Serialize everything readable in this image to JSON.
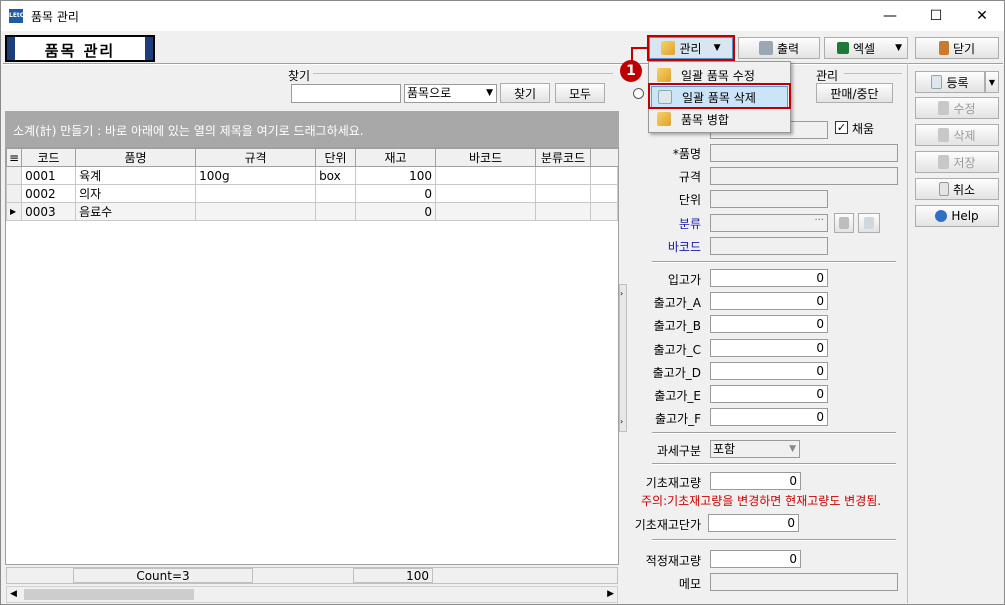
{
  "window": {
    "title": "품목 관리",
    "app_icon_text": "LEtC",
    "min": "—",
    "max": "☐",
    "close": "✕"
  },
  "header": {
    "page_title": "품목 관리"
  },
  "toolbar": {
    "manage_label": "관리",
    "print_label": "출력",
    "excel_label": "엑셀",
    "close_label": "닫기"
  },
  "manage_menu": {
    "items": [
      {
        "label": "일괄 품목 수정"
      },
      {
        "label": "일괄 품목 삭제"
      },
      {
        "label": "품목 병합"
      }
    ]
  },
  "annotation": {
    "step": "1"
  },
  "search": {
    "group_label": "찾기",
    "input_value": "",
    "mode_value": "품목으로",
    "find_label": "찾기",
    "all_label": "모두"
  },
  "manage_group": {
    "label": "관리",
    "button_label": "판매/중단"
  },
  "grid": {
    "hint": "소계(計) 만들기 : 바로 아래에 있는 열의 제목을 여기로 드래그하세요.",
    "columns": [
      "코드",
      "품명",
      "규격",
      "단위",
      "재고",
      "바코드",
      "분류코드"
    ],
    "rows": [
      {
        "code": "0001",
        "name": "육계",
        "spec": "100g",
        "unit": "box",
        "stock": "100",
        "barcode": "",
        "cat": ""
      },
      {
        "code": "0002",
        "name": "의자",
        "spec": "",
        "unit": "",
        "stock": "0",
        "barcode": "",
        "cat": ""
      },
      {
        "code": "0003",
        "name": "음료수",
        "spec": "",
        "unit": "",
        "stock": "0",
        "barcode": "",
        "cat": ""
      }
    ],
    "footer_count": "Count=3",
    "footer_stock": "100"
  },
  "form": {
    "adopt_label": "채움",
    "name_label": "*품명",
    "spec_label": "규격",
    "unit_label": "단위",
    "category_label": "분류",
    "barcode_label": "바코드",
    "price_in_label": "입고가",
    "price_in": "0",
    "price_a_label": "출고가_A",
    "price_a": "0",
    "price_b_label": "출고가_B",
    "price_b": "0",
    "price_c_label": "출고가_C",
    "price_c": "0",
    "price_d_label": "출고가_D",
    "price_d": "0",
    "price_e_label": "출고가_E",
    "price_e": "0",
    "price_f_label": "출고가_F",
    "price_f": "0",
    "tax_label": "과세구분",
    "tax_value": "포함",
    "base_qty_label": "기초재고량",
    "base_qty": "0",
    "warning": "주의:기초재고량을 변경하면 현재고량도 변경됨.",
    "base_price_label": "기초재고단가",
    "base_price": "0",
    "proper_qty_label": "적정재고량",
    "proper_qty": "0",
    "memo_label": "메모",
    "warning_color": "#cc0000",
    "link_color": "#1a1aa6"
  },
  "side_buttons": {
    "register": "등록",
    "edit": "수정",
    "delete": "삭제",
    "save": "저장",
    "cancel": "취소",
    "help": "Help"
  }
}
